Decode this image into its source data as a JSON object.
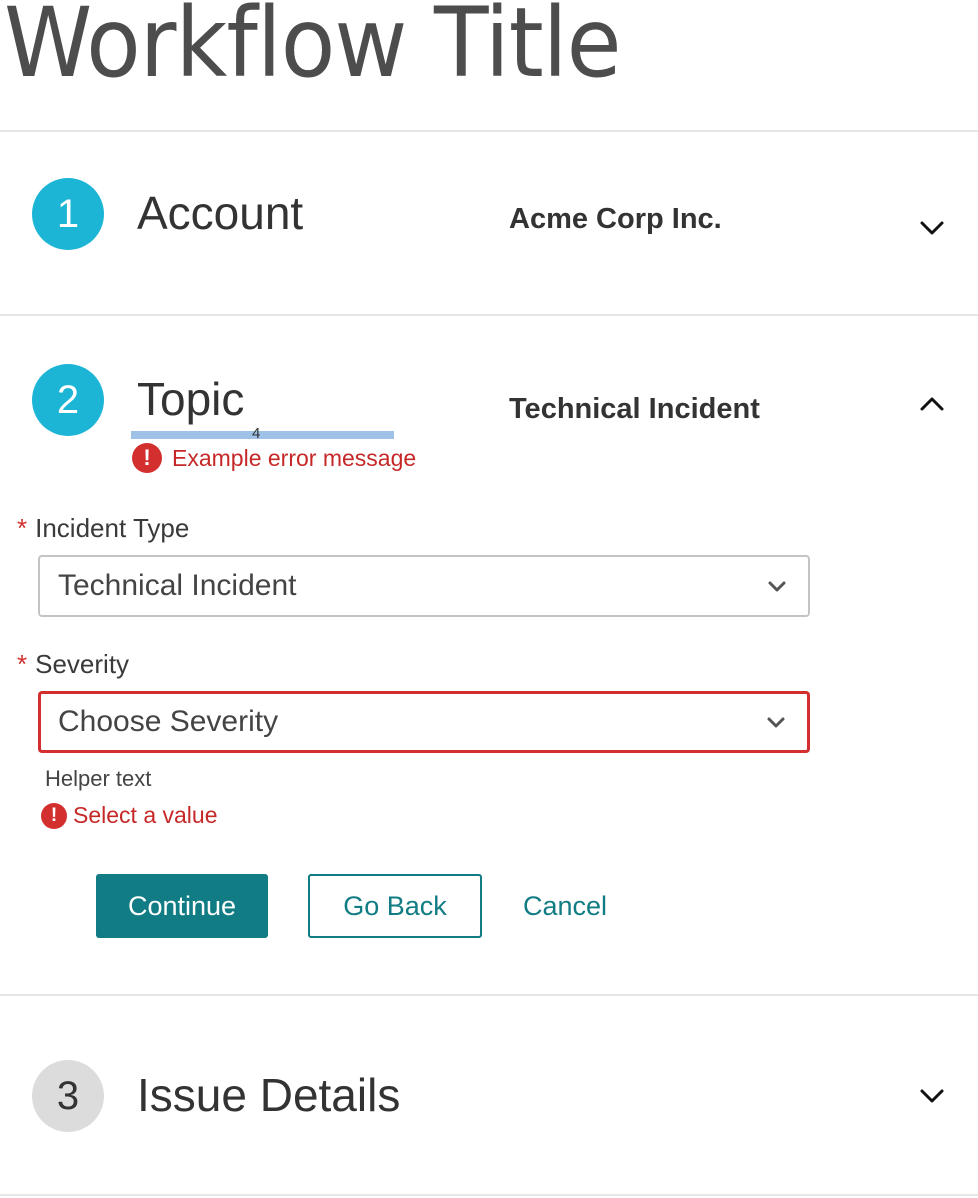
{
  "page": {
    "title": "Workflow Title"
  },
  "colors": {
    "active_step": "#1cb5d6",
    "inactive_step": "#dcdcdc",
    "error": "#d32f2f",
    "primary": "#117c83",
    "focus_bar": "#9fc1e8"
  },
  "steps": [
    {
      "number": "1",
      "title": "Account",
      "summary": "Acme Corp Inc.",
      "state": "collapsed",
      "icon": "chevron-down-icon"
    },
    {
      "number": "2",
      "title": "Topic",
      "summary": "Technical Incident",
      "state": "expanded",
      "icon": "chevron-up-icon",
      "focus_indicator": "4",
      "error_message": "Example error message"
    },
    {
      "number": "3",
      "title": "Issue Details",
      "summary": "",
      "state": "collapsed",
      "icon": "chevron-down-icon"
    }
  ],
  "form": {
    "required_mark": "*",
    "incident_type": {
      "label": "Incident Type",
      "value": "Technical Incident"
    },
    "severity": {
      "label": "Severity",
      "value": "Choose Severity",
      "helper_text": "Helper text",
      "error": "Select a value"
    }
  },
  "actions": {
    "continue_label": "Continue",
    "go_back_label": "Go Back",
    "cancel_label": "Cancel"
  }
}
